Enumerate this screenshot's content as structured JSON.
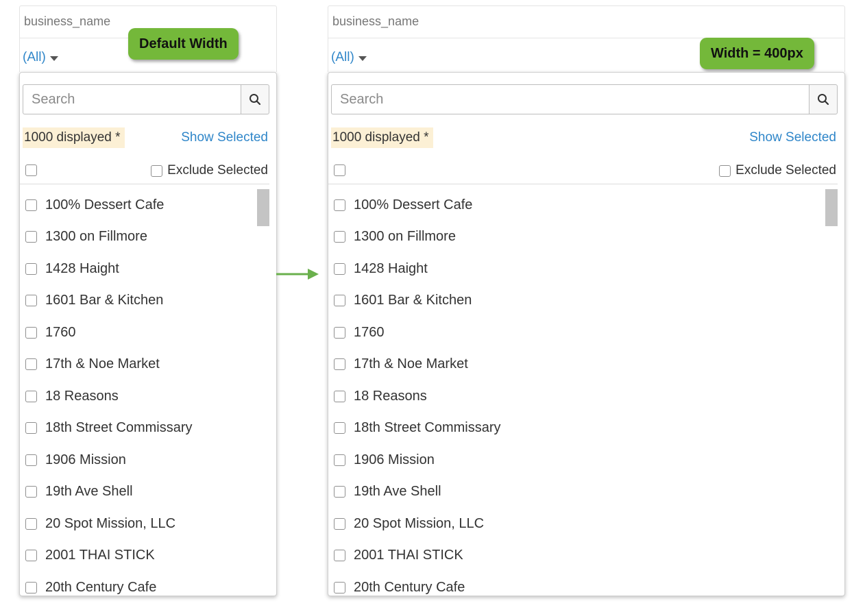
{
  "filter_field": "business_name",
  "all_label": "(All)",
  "search_placeholder": "Search",
  "displayed_text": "1000 displayed *",
  "show_selected": "Show Selected",
  "exclude_selected": "Exclude Selected",
  "callouts": {
    "left": "Default Width",
    "right": "Width = 400px"
  },
  "items": [
    "100% Dessert Cafe",
    "1300 on Fillmore",
    "1428 Haight",
    "1601 Bar & Kitchen",
    "1760",
    "17th & Noe Market",
    "18 Reasons",
    "18th Street Commissary",
    "1906 Mission",
    "19th Ave Shell",
    "20 Spot Mission, LLC",
    "2001 THAI STICK",
    "20th Century Cafe"
  ],
  "icons": {
    "search": "search-icon",
    "caret": "caret-down-icon",
    "arrow": "arrow-right-icon"
  },
  "colors": {
    "link": "#2f86c9",
    "callout": "#74b83a",
    "displayed_highlight": "#fcf0d5",
    "arrow": "#6ab04c"
  }
}
